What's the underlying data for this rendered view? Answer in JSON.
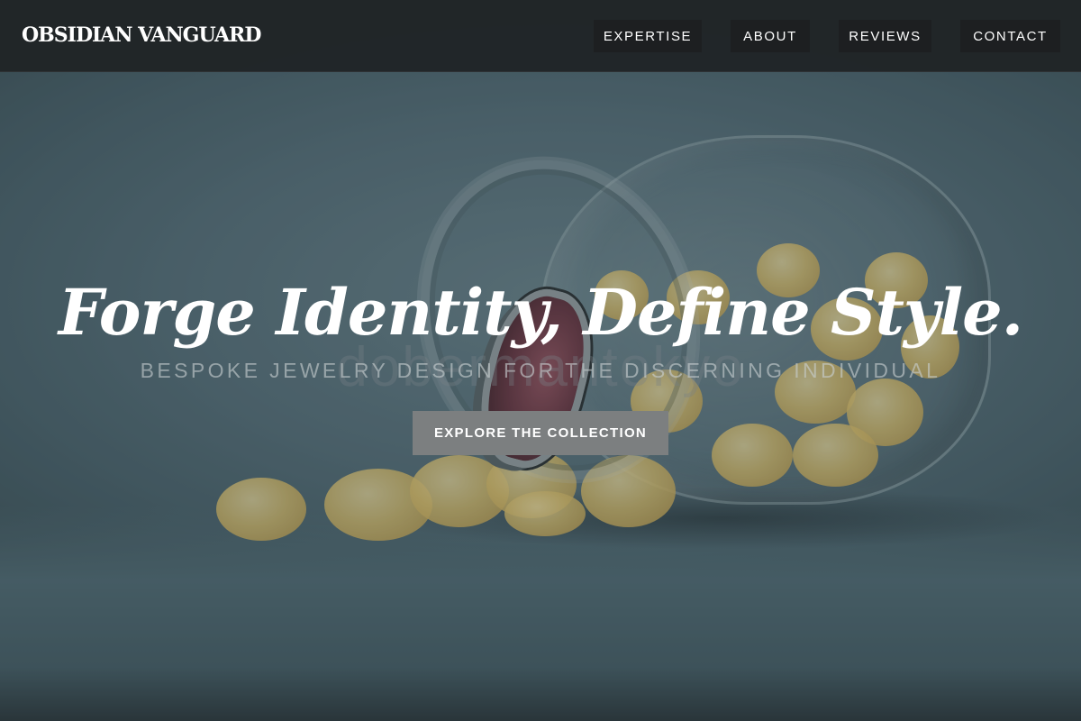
{
  "brand": {
    "name": "OBSIDIAN VANGUARD"
  },
  "nav": {
    "items": [
      {
        "label": "EXPERTISE"
      },
      {
        "label": "ABOUT"
      },
      {
        "label": "REVIEWS"
      },
      {
        "label": "CONTACT"
      }
    ]
  },
  "hero": {
    "headline": "Forge Identity, Define Style.",
    "subheadline": "BESPOKE JEWELRY DESIGN FOR THE DISCERNING INDIVIDUAL",
    "cta_label": "EXPLORE THE COLLECTION",
    "watermark": "dobermantokyo"
  },
  "colors": {
    "nav_background": "#202426",
    "nav_button": "#1d1f21",
    "cta_button": "#7c7f80",
    "text": "#ffffff"
  }
}
